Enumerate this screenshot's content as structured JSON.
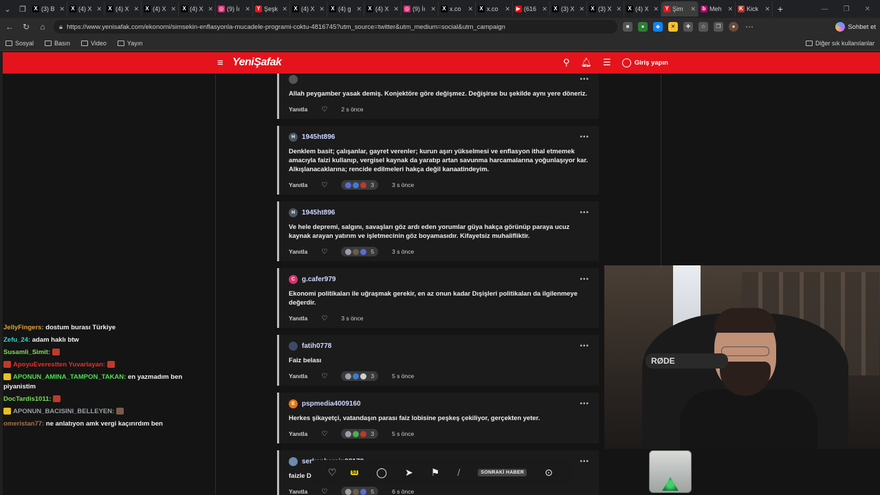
{
  "browser": {
    "tabs": [
      {
        "label": "(3) B",
        "fav": "X",
        "color": "#000000"
      },
      {
        "label": "(4) X",
        "fav": "X",
        "color": "#000000"
      },
      {
        "label": "(4) X",
        "fav": "X",
        "color": "#000000"
      },
      {
        "label": "(4) X",
        "fav": "X",
        "color": "#000000"
      },
      {
        "label": "(4) X",
        "fav": "X",
        "color": "#000000"
      },
      {
        "label": "(9) İı",
        "fav": "◎",
        "color": "#d62976"
      },
      {
        "label": "Şeşk",
        "fav": "Y",
        "color": "#e5141c"
      },
      {
        "label": "(4) X",
        "fav": "X",
        "color": "#000000"
      },
      {
        "label": "(4) g",
        "fav": "X",
        "color": "#000000"
      },
      {
        "label": "(4) X",
        "fav": "X",
        "color": "#000000"
      },
      {
        "label": "(9) İı",
        "fav": "◎",
        "color": "#d62976"
      },
      {
        "label": "x.co",
        "fav": "X",
        "color": "#000000"
      },
      {
        "label": "x.co",
        "fav": "X",
        "color": "#000000"
      },
      {
        "label": "(616",
        "fav": "▶",
        "color": "#ff0000"
      },
      {
        "label": "(3) X",
        "fav": "X",
        "color": "#000000"
      },
      {
        "label": "(3) X",
        "fav": "X",
        "color": "#000000"
      },
      {
        "label": "(4) X",
        "fav": "X",
        "color": "#000000"
      },
      {
        "label": "Şim",
        "fav": "Y",
        "color": "#e5141c",
        "active": true
      },
      {
        "label": "Meh",
        "fav": "b",
        "color": "#b9006e"
      },
      {
        "label": "Kick",
        "fav": "K",
        "color": "#b9332a"
      }
    ],
    "new_tab": "+",
    "url": "https://www.yenisafak.com/ekonomi/simsekin-enflasyonla-mucadele-programi-coktu-4816745?utm_source=twitter&utm_medium=social&utm_campaign",
    "chat_label": "Sohbet et",
    "bookmarks": [
      "Sosyal",
      "Basın",
      "Video",
      "Yayın"
    ],
    "other_bookmarks": "Diğer sık kullanılanlar"
  },
  "site": {
    "logo": "YeniŞafak",
    "login": "Giriş yapın"
  },
  "comments": [
    {
      "user": "",
      "avatar": "",
      "avatar_color": "#555555",
      "text": "Allah peygamber yasak demiş. Konjektöre göre değişmez. Değişirse bu şekilde aynı yere döneriz.",
      "reply": "Yanıtla",
      "reactions": null,
      "time": "2 s önce"
    },
    {
      "user": "1945ht896",
      "avatar": "H",
      "avatar_color": "#4a5560",
      "text": "Denklem basit; çalışanlar, gayret verenler; kurun aşırı yükselmesi ve enflasyon ithal etmemek amacıyla faizi kullanıp, vergisel kaynak da yaratıp artan savunma harcamalarına yoğunlaşıyor kar. Alkışlanacaklarına; rencide edilmeleri hakça değil kanaatindeyim.",
      "reply": "Yanıtla",
      "reactions": {
        "count": "3",
        "dots": [
          "#5b6bd6",
          "#3b7bd6",
          "#c0392b"
        ]
      },
      "time": "3 s önce"
    },
    {
      "user": "1945ht896",
      "avatar": "H",
      "avatar_color": "#4a5560",
      "text": "Ve hele depremi, salgını, savaşları göz ardı eden yorumlar güya hakça görünüp paraya ucuz kaynak arayan yatırım ve işletmecinin göz boyamasıdır. Kifayetsiz muhalifliktir.",
      "reply": "Yanıtla",
      "reactions": {
        "count": "5",
        "dots": [
          "#9aa0a6",
          "#6b5b4b",
          "#5b6bd6"
        ]
      },
      "time": "3 s önce"
    },
    {
      "user": "g.cafer979",
      "avatar": "C",
      "avatar_color": "#d6336c",
      "text": "Ekonomi politikaları ile uğraşmak gerekir, en az onun kadar Dışişleri politikaları da ilgilenmeye değerdir.",
      "reply": "Yanıtla",
      "reactions": null,
      "time": "3 s önce"
    },
    {
      "user": "fatih0778",
      "avatar": "",
      "avatar_color": "#3d4a66",
      "text": "Faiz belası",
      "reply": "Yanıtla",
      "reactions": {
        "count": "3",
        "dots": [
          "#9aa0a6",
          "#3b7bd6",
          "#d0d0d0"
        ]
      },
      "time": "5 s önce"
    },
    {
      "user": "pspmedia4009160",
      "avatar": "E",
      "avatar_color": "#e8740c",
      "text": "Herkes şikayetçi, vatandaşın parası faiz lobisine peşkeş çekiliyor, gerçekten yeter.",
      "reply": "Yanıtla",
      "reactions": {
        "count": "3",
        "dots": [
          "#9aa0a6",
          "#4caf50",
          "#c0392b"
        ]
      },
      "time": "5 s önce"
    },
    {
      "user": "serkanbercin98172",
      "avatar": "",
      "avatar_color": "#6a8caf",
      "text": "faizle D... yüksel...",
      "reply": "Yanıtla",
      "reactions": {
        "count": "5",
        "dots": [
          "#9aa0a6",
          "#6b5b4b",
          "#5b6bd6"
        ]
      },
      "time": "6 s önce"
    }
  ],
  "toolbar": {
    "badge": "53",
    "next_label": "SONRAKİ HABER",
    "trail": "yor"
  },
  "chat": [
    {
      "name": "JellyFingers",
      "name_color": "#e0a23a",
      "text": "dostum burası Türkiye"
    },
    {
      "name": "Zefu_24",
      "name_color": "#3bd1d1",
      "text": "adam haklı btw"
    },
    {
      "name": "Susamli_Simit",
      "name_color": "#7ddc5a",
      "text": "",
      "emote": "#c0392b"
    },
    {
      "name": "ApoyuEverestten Yuvarlayan",
      "name_color": "#e0322c",
      "text": "",
      "emote": "#c0392b",
      "prefix_emote": "#c0392b"
    },
    {
      "name": "APONUN_AMINA_TAMPON_TAKAN",
      "name_color": "#4ee04e",
      "text": "en yazmadım ben piyanistim",
      "prefix_emote": "#e8c020"
    },
    {
      "name": "DocTardis1011",
      "name_color": "#7ddc5a",
      "text": "",
      "emote": "#c0392b"
    },
    {
      "name": "APONUN_BACISINI_BELLEYEN",
      "name_color": "#9aa0a6",
      "text": "",
      "emote": "#7b5b4b",
      "prefix_emote": "#e8c020"
    },
    {
      "name": "omeristan77",
      "name_color": "#a7724a",
      "text": "ne anlatıyon amk vergi kaçırırdım ben"
    }
  ],
  "cam": {
    "mic_brand": "RØDE"
  }
}
